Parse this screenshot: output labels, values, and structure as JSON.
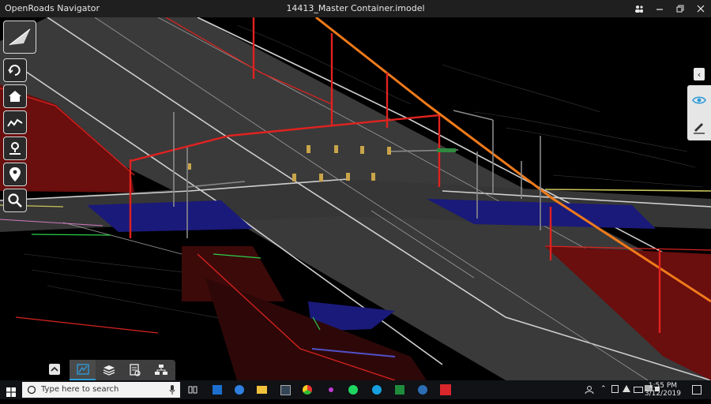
{
  "window": {
    "app_title": "OpenRoads Navigator",
    "document_title": "14413_Master Container.imodel",
    "controls": [
      "people-icon",
      "minimize-icon",
      "restore-icon",
      "close-icon"
    ]
  },
  "left_toolbar": {
    "tools": [
      "view-tool-icon",
      "rotate-view-icon",
      "home-icon",
      "measure-icon",
      "walk-icon",
      "location-pin-icon",
      "search-icon"
    ]
  },
  "right_panel": {
    "tools": [
      "visibility-eye-icon",
      "markup-pen-icon"
    ],
    "accent": "#2e9bd8"
  },
  "bottom_toolbar": {
    "tabs": [
      "model-view-icon",
      "layers-icon",
      "properties-icon",
      "tree-icon"
    ],
    "active_index": 0
  },
  "taskbar": {
    "search_placeholder": "Type here to search",
    "time": "1:55 PM",
    "date": "3/12/2019"
  },
  "scene_colors": {
    "background": "#000000",
    "road": "#3a3a3a",
    "poles": "#e0221f",
    "orange_line": "#f07a1a",
    "blue_zone": "#1a1a7a",
    "red_slope": "#6a0e0e"
  }
}
